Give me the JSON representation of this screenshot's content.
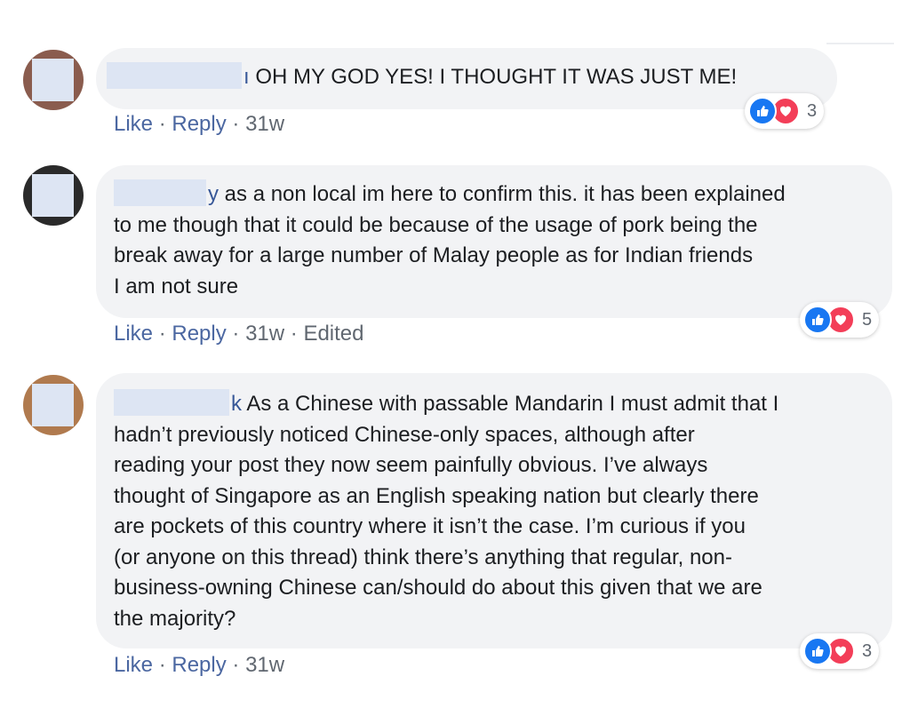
{
  "colors": {
    "bubble": "#f2f3f5",
    "link": "#4b67a1",
    "muted": "#606770",
    "like": "#1877f2",
    "love": "#f33e58",
    "redaction": "#dde5f3"
  },
  "comments": [
    {
      "name_tail": "ı",
      "text": "OH MY GOD YES! I THOUGHT IT WAS JUST ME!",
      "like_label": "Like",
      "reply_label": "Reply",
      "separator": "·",
      "time": "31w",
      "edited": "",
      "reaction_icons": [
        "like-icon",
        "love-icon"
      ],
      "reaction_count": "3"
    },
    {
      "name_tail": "y",
      "text": "as a non local im here to confirm this. it has been explained\nto me though that it could be because of the usage of pork being the\nbreak away for a large number of Malay people as for Indian friends\nI am not sure",
      "like_label": "Like",
      "reply_label": "Reply",
      "separator": "·",
      "time": "31w",
      "edited": "Edited",
      "reaction_icons": [
        "like-icon",
        "love-icon"
      ],
      "reaction_count": "5"
    },
    {
      "name_tail": "k",
      "text": "As a Chinese with passable Mandarin I must admit that I\nhadn’t previously noticed Chinese-only spaces, although after\nreading your post they now seem painfully obvious. I’ve always\nthought of Singapore as an English speaking nation but clearly there\nare pockets of this country where it isn’t the case. I’m curious if you\n(or anyone on this thread) think there’s anything that regular, non-\nbusiness-owning Chinese can/should do about this given that we are\nthe majority?",
      "like_label": "Like",
      "reply_label": "Reply",
      "separator": "·",
      "time": "31w",
      "edited": "",
      "reaction_icons": [
        "like-icon",
        "love-icon"
      ],
      "reaction_count": "3"
    }
  ]
}
